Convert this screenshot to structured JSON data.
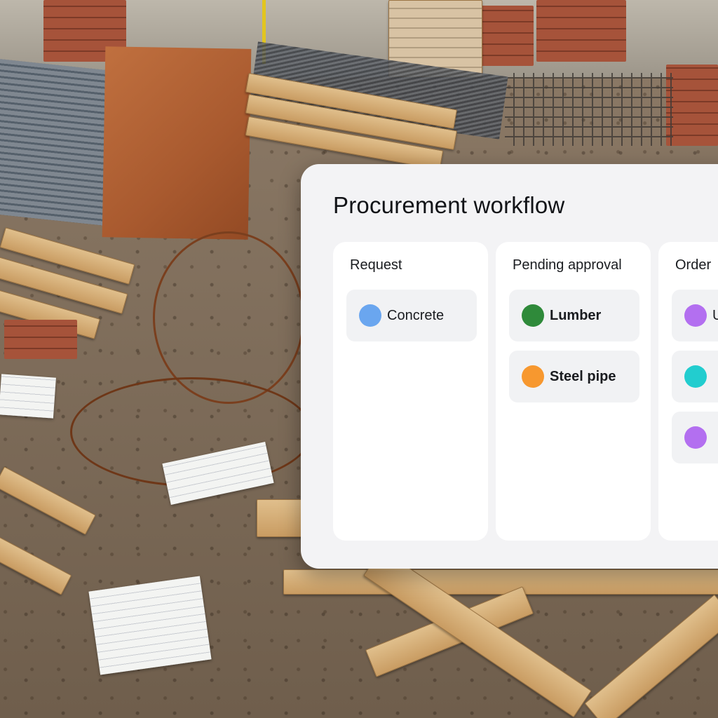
{
  "panel": {
    "title": "Procurement workflow"
  },
  "columns": [
    {
      "title": "Request",
      "cards": [
        {
          "label": "Concrete",
          "color": "#6aa6ef"
        }
      ]
    },
    {
      "title": "Pending approval",
      "cards": [
        {
          "label": "Lumber",
          "color": "#2f8a3a"
        },
        {
          "label": "Steel pipe",
          "color": "#f7982f"
        }
      ]
    },
    {
      "title": "Order",
      "cards": [
        {
          "label": "U",
          "color": "#b36ff0"
        },
        {
          "label": "",
          "color": "#22cdcf"
        },
        {
          "label": "",
          "color": "#b36ff0"
        }
      ]
    }
  ]
}
